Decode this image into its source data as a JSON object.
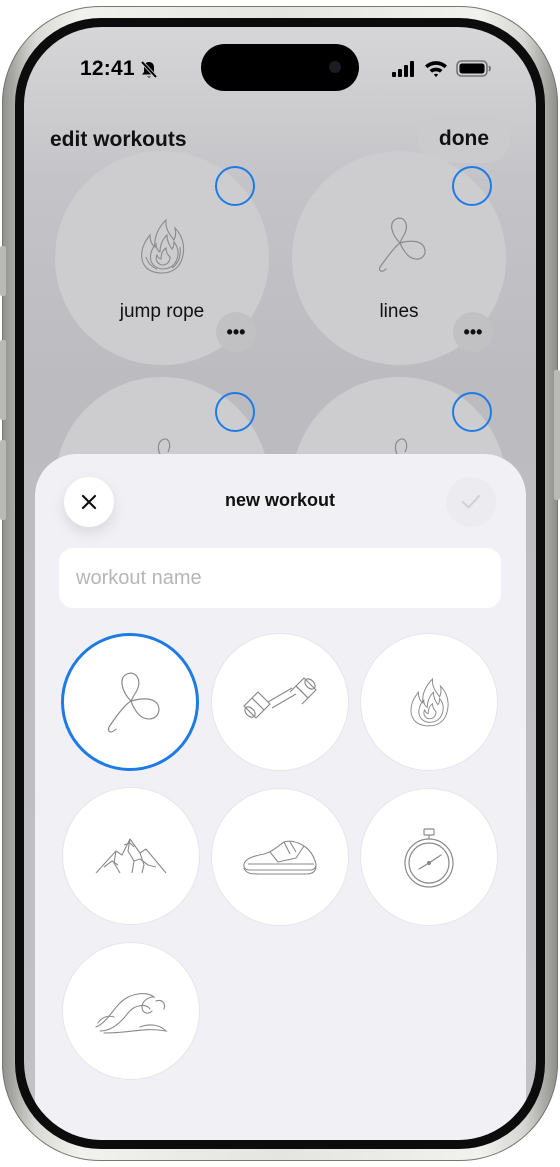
{
  "status_bar": {
    "time": "12:41",
    "silent_icon": "bell-slash-icon",
    "signal_icon": "cellular-signal-icon",
    "wifi_icon": "wifi-icon",
    "battery_icon": "battery-icon"
  },
  "header": {
    "title": "edit workouts",
    "done_label": "done"
  },
  "workouts": [
    {
      "label": "jump rope",
      "icon": "flame-icon"
    },
    {
      "label": "lines",
      "icon": "infinity-loop-icon"
    },
    {
      "label": "",
      "icon": "infinity-loop-icon"
    },
    {
      "label": "",
      "icon": "infinity-loop-icon"
    }
  ],
  "sheet": {
    "title": "new workout",
    "close_icon": "close-icon",
    "confirm_icon": "checkmark-icon",
    "name_placeholder": "workout name",
    "name_value": "",
    "icon_options": [
      "infinity-loop-icon",
      "dumbbell-icon",
      "flame-icon",
      "mountain-icon",
      "sneaker-icon",
      "stopwatch-icon",
      "wave-icon"
    ],
    "selected_icon": "infinity-loop-icon"
  },
  "colors": {
    "accent": "#1e7be6",
    "sheet_background": "#f1f1f5",
    "icon_stroke": "#8a8a8e"
  }
}
